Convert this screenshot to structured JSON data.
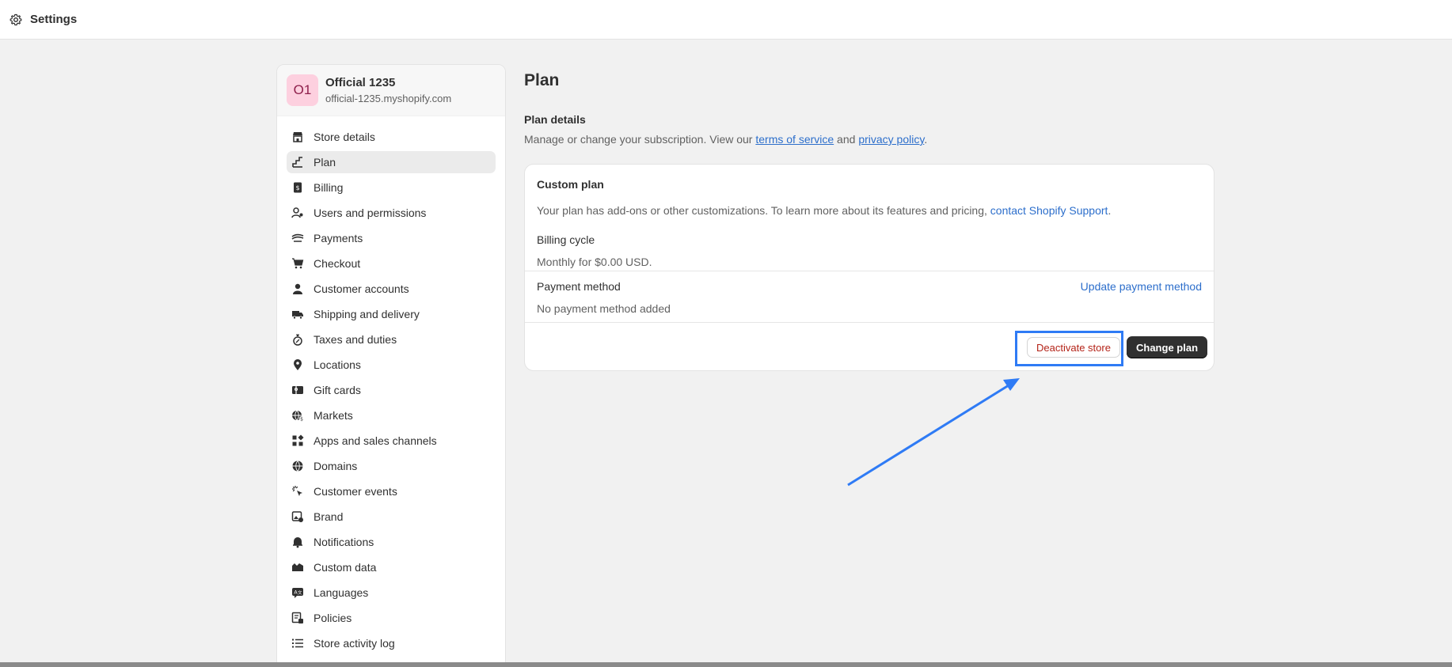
{
  "topbar": {
    "title": "Settings",
    "icon": "gear-icon"
  },
  "store": {
    "initials": "O1",
    "name": "Official 1235",
    "url": "official-1235.myshopify.com",
    "avatar_bg": "#fdd0df"
  },
  "sidebar": {
    "active_item": "Plan",
    "items": [
      {
        "label": "Store details",
        "icon": "store-icon"
      },
      {
        "label": "Plan",
        "icon": "plan-icon"
      },
      {
        "label": "Billing",
        "icon": "billing-icon"
      },
      {
        "label": "Users and permissions",
        "icon": "users-icon"
      },
      {
        "label": "Payments",
        "icon": "payments-icon"
      },
      {
        "label": "Checkout",
        "icon": "cart-icon"
      },
      {
        "label": "Customer accounts",
        "icon": "person-icon"
      },
      {
        "label": "Shipping and delivery",
        "icon": "truck-icon"
      },
      {
        "label": "Taxes and duties",
        "icon": "tax-icon"
      },
      {
        "label": "Locations",
        "icon": "location-icon"
      },
      {
        "label": "Gift cards",
        "icon": "gift-card-icon"
      },
      {
        "label": "Markets",
        "icon": "globe-dollar-icon"
      },
      {
        "label": "Apps and sales channels",
        "icon": "apps-icon"
      },
      {
        "label": "Domains",
        "icon": "globe-icon"
      },
      {
        "label": "Customer events",
        "icon": "cursor-click-icon"
      },
      {
        "label": "Brand",
        "icon": "brand-icon"
      },
      {
        "label": "Notifications",
        "icon": "bell-icon"
      },
      {
        "label": "Custom data",
        "icon": "database-icon"
      },
      {
        "label": "Languages",
        "icon": "language-icon"
      },
      {
        "label": "Policies",
        "icon": "policy-icon"
      },
      {
        "label": "Store activity log",
        "icon": "list-icon"
      }
    ]
  },
  "main": {
    "title": "Plan",
    "plan_details": {
      "title": "Plan details",
      "desc_prefix": "Manage or change your subscription. View our ",
      "terms_link": "terms of service",
      "desc_and": " and ",
      "privacy_link": "privacy policy",
      "desc_suffix": "."
    },
    "card": {
      "custom_plan_label": "Custom plan",
      "custom_plan_text": "Your plan has add-ons or other customizations. To learn more about its features and pricing, ",
      "support_link": "contact Shopify Support",
      "support_suffix": ".",
      "billing_cycle_label": "Billing cycle",
      "billing_cycle_value": "Monthly for $0.00 USD.",
      "payment_method_label": "Payment method",
      "payment_method_value": "No payment method added",
      "update_payment_link": "Update payment method",
      "deactivate_button": "Deactivate store",
      "change_plan_button": "Change plan"
    }
  },
  "colors": {
    "accent_link": "#2c6ecb",
    "annotation": "#2f7bf5",
    "danger": "#b42318",
    "primary_button": "#303030"
  }
}
